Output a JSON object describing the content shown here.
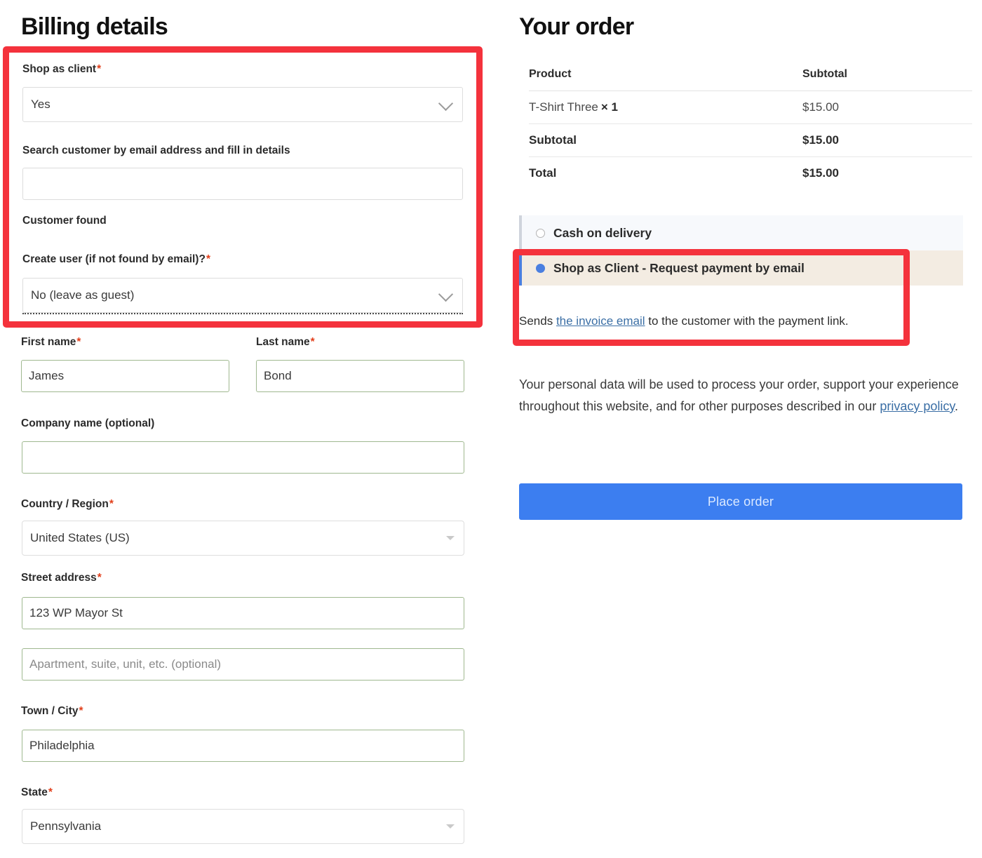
{
  "billing": {
    "title": "Billing details",
    "shop_as_client": {
      "label": "Shop as client",
      "required": "*",
      "value": "Yes"
    },
    "search_customer": {
      "label": "Search customer by email address and fill in details",
      "value": "",
      "placeholder": ""
    },
    "customer_found": {
      "label": "Customer found"
    },
    "create_user": {
      "label": "Create user (if not found by email)?",
      "required": "*",
      "value": "No (leave as guest)"
    },
    "first_name": {
      "label": "First name",
      "required": "*",
      "value": "James"
    },
    "last_name": {
      "label": "Last name",
      "required": "*",
      "value": "Bond"
    },
    "company_name": {
      "label": "Company name (optional)",
      "value": ""
    },
    "country_region": {
      "label": "Country / Region",
      "required": "*",
      "value": "United States (US)"
    },
    "street_address": {
      "label": "Street address",
      "required": "*",
      "value": "123 WP Mayor St",
      "line2_value": "",
      "line2_placeholder": "Apartment, suite, unit, etc. (optional)"
    },
    "town_city": {
      "label": "Town / City",
      "required": "*",
      "value": "Philadelphia"
    },
    "state": {
      "label": "State",
      "required": "*",
      "value": "Pennsylvania"
    }
  },
  "order": {
    "title": "Your order",
    "table": {
      "headers": [
        "Product",
        "Subtotal"
      ],
      "line_items": [
        {
          "name": "T-Shirt Three",
          "qty": "× 1",
          "subtotal": "$15.00"
        }
      ],
      "subtotal": {
        "label": "Subtotal",
        "value": "$15.00"
      },
      "total": {
        "label": "Total",
        "value": "$15.00"
      }
    },
    "payment_methods": [
      {
        "label": "Cash on delivery",
        "selected": false
      },
      {
        "label": "Shop as Client - Request payment by email",
        "selected": true
      }
    ],
    "payment_description": {
      "before": "Sends ",
      "link": "the invoice email",
      "after": " to the customer with the payment link."
    },
    "privacy_notice": {
      "before": "Your personal data will be used to process your order, support your experience throughout this website, and for other purposes described in our ",
      "link": "privacy policy",
      "after": "."
    },
    "place_order_label": "Place order"
  },
  "colors": {
    "highlight": "#f4323c",
    "accent_blue": "#3c7ef0",
    "selected_row_bg": "#f3ece2",
    "unselected_row_bg": "#f7f9fc",
    "required_star": "#e2401c",
    "link": "#3a6ea5",
    "valid_field_border": "#9fb88f"
  }
}
